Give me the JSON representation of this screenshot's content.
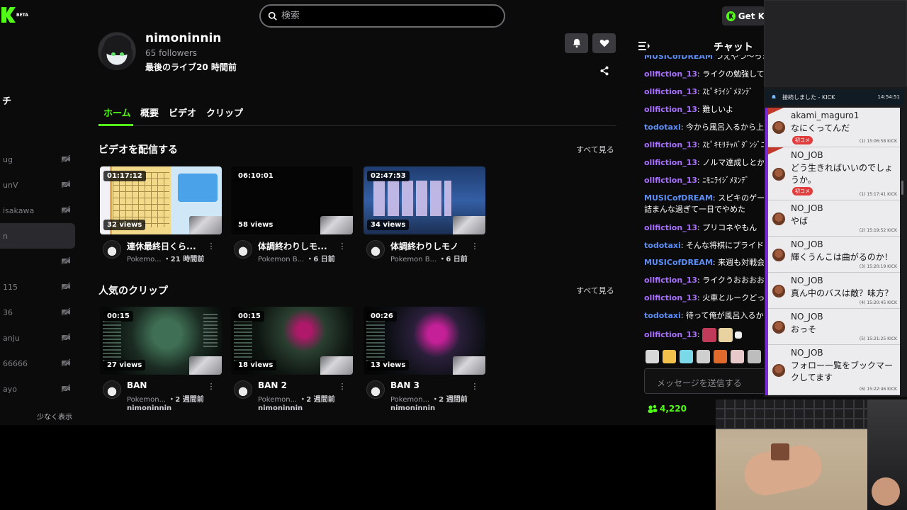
{
  "app": {
    "logo_text": "K",
    "beta_label": "BETA",
    "accent_color": "#53fc18",
    "get_kick_label": "Get K"
  },
  "search": {
    "placeholder": "検索"
  },
  "sidebar": {
    "header": "チ",
    "items": [
      {
        "label": "ug",
        "active": false
      },
      {
        "label": "unV",
        "active": false
      },
      {
        "label": "isakawa",
        "active": false
      },
      {
        "label": "n",
        "active": true
      },
      {
        "label": "",
        "active": false
      },
      {
        "label": "115",
        "active": false
      },
      {
        "label": "36",
        "active": false
      },
      {
        "label": "anju",
        "active": false
      },
      {
        "label": "66666",
        "active": false
      },
      {
        "label": "ayo",
        "active": false
      }
    ],
    "show_less": "少なく表示"
  },
  "channel": {
    "name": "nimoninnin",
    "followers": "65 followers",
    "last_live": "最後のライブ20 時間前"
  },
  "tabs": [
    {
      "label": "ホーム",
      "active": true
    },
    {
      "label": "概要",
      "active": false
    },
    {
      "label": "ビデオ",
      "active": false
    },
    {
      "label": "クリップ",
      "active": false
    }
  ],
  "videos_section": {
    "title": "ビデオを配信する",
    "see_all": "すべて見る",
    "items": [
      {
        "duration": "01:17:12",
        "views": "32 views",
        "title": "連休最終日くら...",
        "category": "Pokemo...",
        "age": "・21 時間前",
        "thumb": "t-shogi"
      },
      {
        "duration": "06:10:01",
        "views": "58 views",
        "title": "体調終わりしモ...",
        "category": "Pokemon B...",
        "age": "・6 日前",
        "thumb": "t-dark"
      },
      {
        "duration": "02:47:53",
        "views": "34 views",
        "title": "体調終わりしモノ",
        "category": "Pokemon B...",
        "age": "・6 日前",
        "thumb": "t-cards"
      }
    ]
  },
  "clips_section": {
    "title": "人気のクリップ",
    "see_all": "すべて見る",
    "items": [
      {
        "duration": "00:15",
        "views": "27 views",
        "title": "BAN",
        "category": "Pokemon...",
        "age": "・2 週間前",
        "owner": "nimoninnin",
        "thumb": "t-game"
      },
      {
        "duration": "00:15",
        "views": "18 views",
        "title": "BAN 2",
        "category": "Pokemon...",
        "age": "・2 週間前",
        "owner": "nimoninnin",
        "thumb": "t-game2"
      },
      {
        "duration": "00:26",
        "views": "13 views",
        "title": "BAN 3",
        "category": "Pokemon...",
        "age": "・2 週間前",
        "owner": "nimoninnin",
        "thumb": "t-game3"
      }
    ]
  },
  "chat": {
    "title": "チャット",
    "messages": [
      {
        "user": "MUSICofDREAM",
        "text": " つえやつ～っま",
        "color": "#5b8df5",
        "clipped": true
      },
      {
        "user": "ollfiction_13",
        "text": ": ライクの勉強しておい",
        "color": "#a970ff"
      },
      {
        "user": "ollfiction_13",
        "text": ": ｽﾋﾟｷﾗｲｼﾞﾒﾇﾝﾃﾞ",
        "color": "#a970ff"
      },
      {
        "user": "ollfiction_13",
        "text": ": 難しいよ",
        "color": "#a970ff"
      },
      {
        "user": "todotaxi",
        "text": ": 今から風呂入るから上が",
        "color": "#5b8df5"
      },
      {
        "user": "ollfiction_13",
        "text": ": ｽﾋﾟｷﾓﾘﾁｬﾊﾞﾀﾞﾝｼﾞﾆﾞﾊﾞ",
        "color": "#a970ff"
      },
      {
        "user": "ollfiction_13",
        "text": ": ノルマ達成しとかな",
        "color": "#a970ff"
      },
      {
        "user": "ollfiction_13",
        "text": ": ﾆﾓﾆﾗｲｼﾞﾒﾇﾝﾃﾞ",
        "color": "#a970ff"
      },
      {
        "user": "MUSICofDREAM",
        "text": ": スピキのゲーム",
        "text2": "詰まんな過ぎて一日でやめた",
        "color": "#5b8df5"
      },
      {
        "user": "ollfiction_13",
        "text": ": プリコネやもん",
        "color": "#a970ff"
      },
      {
        "user": "todotaxi",
        "text": ": そんな将棋にプライド合",
        "color": "#5b8df5"
      },
      {
        "user": "MUSICofDREAM",
        "text": ": 来週も対戦会し",
        "color": "#5b8df5"
      },
      {
        "user": "ollfiction_13",
        "text": ": ライクうおおおおお",
        "color": "#a970ff"
      },
      {
        "user": "ollfiction_13",
        "text": ": 火車とルークどっち",
        "color": "#a970ff"
      },
      {
        "user": "todotaxi",
        "text": ": 待って俺が風呂入るから",
        "color": "#5b8df5"
      },
      {
        "user": "ollfiction_13",
        "text": ":",
        "color": "#a970ff",
        "emotes": true
      }
    ],
    "input_placeholder": "メッセージを送信する",
    "viewer_count": "4,220"
  },
  "overlay": {
    "connection_text": "接続しました - KICK",
    "connection_time": "14:54:51",
    "comments": [
      {
        "name": "akami_maguro1",
        "text": "なにくってんだ",
        "badge": "初コメ",
        "meta": "(1)  15:06:58  KICK",
        "new": true
      },
      {
        "name": "NO_JOB",
        "text": "どう生きればいいのでしょうか。",
        "badge": "初コメ",
        "meta": "(1)  15:17:41  KICK",
        "new": true
      },
      {
        "name": "NO_JOB",
        "text": "やば",
        "badge": "",
        "meta": "(2)  15:19:52  KICK",
        "new": false
      },
      {
        "name": "NO_JOB",
        "text": "輝くうんこは曲がるのか！",
        "badge": "",
        "meta": "(3)  15:20:19  KICK",
        "new": false
      },
      {
        "name": "NO_JOB",
        "text": "真ん中のバスは敵？味方？",
        "badge": "",
        "meta": "(4)  15:20:45  KICK",
        "new": false
      },
      {
        "name": "NO_JOB",
        "text": "おっそ",
        "badge": "",
        "meta": "(5)  15:21:25  KICK",
        "new": false
      },
      {
        "name": "NO_JOB",
        "text": "フォロー一覧をブックマークしてます",
        "badge": "",
        "meta": "(6)  15:22:46  KICK",
        "new": false
      }
    ]
  }
}
